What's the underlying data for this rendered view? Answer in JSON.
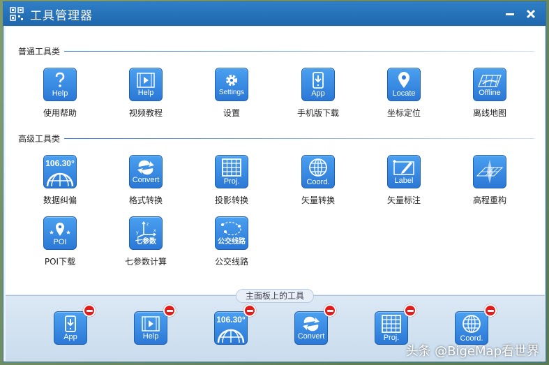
{
  "window": {
    "title": "工具管理器",
    "minimize_icon": "minimize-icon",
    "close_icon": "close-icon"
  },
  "sections": {
    "common": "普通工具类",
    "advanced": "高级工具类"
  },
  "common_tools": [
    {
      "label": "使用帮助",
      "cap": "Help",
      "icon": "question-icon"
    },
    {
      "label": "视频教程",
      "cap": "Help",
      "icon": "video-icon"
    },
    {
      "label": "设置",
      "cap": "Settings",
      "icon": "gear-icon"
    },
    {
      "label": "手机版下载",
      "cap": "App",
      "icon": "phone-download-icon"
    },
    {
      "label": "坐标定位",
      "cap": "Locate",
      "icon": "location-pin-icon"
    },
    {
      "label": "离线地图",
      "cap": "Offline",
      "icon": "offline-map-icon"
    }
  ],
  "advanced_tools": [
    {
      "label": "数据纠偏",
      "cap": "106.30°",
      "icon": "globe-grid-icon"
    },
    {
      "label": "格式转换",
      "cap": "Convert",
      "icon": "convert-arrows-icon"
    },
    {
      "label": "投影转换",
      "cap": "Proj.",
      "icon": "projection-grid-icon"
    },
    {
      "label": "矢量转换",
      "cap": "Coord.",
      "icon": "globe-icon"
    },
    {
      "label": "矢量标注",
      "cap": "Label",
      "icon": "label-pencil-icon"
    },
    {
      "label": "高程重构",
      "cap": "",
      "icon": "terrain-mesh-icon"
    },
    {
      "label": "POI下载",
      "cap": "POI",
      "icon": "poi-pin-icon"
    },
    {
      "label": "七参数计算",
      "cap": "七参数",
      "icon": "axes-icon"
    },
    {
      "label": "公交线路",
      "cap": "公交线路",
      "icon": "bus-route-icon"
    }
  ],
  "bottom_panel": {
    "label": "主面板上的工具",
    "tools": [
      {
        "cap": "App",
        "icon": "phone-download-icon"
      },
      {
        "cap": "Help",
        "icon": "video-icon"
      },
      {
        "cap": "106.30°",
        "icon": "globe-grid-icon"
      },
      {
        "cap": "Convert",
        "icon": "convert-arrows-icon"
      },
      {
        "cap": "Proj.",
        "icon": "projection-grid-icon"
      },
      {
        "cap": "Coord.",
        "icon": "globe-icon"
      }
    ],
    "remove_icon": "remove-icon"
  },
  "watermark": "头条 @BigeMap看世界"
}
